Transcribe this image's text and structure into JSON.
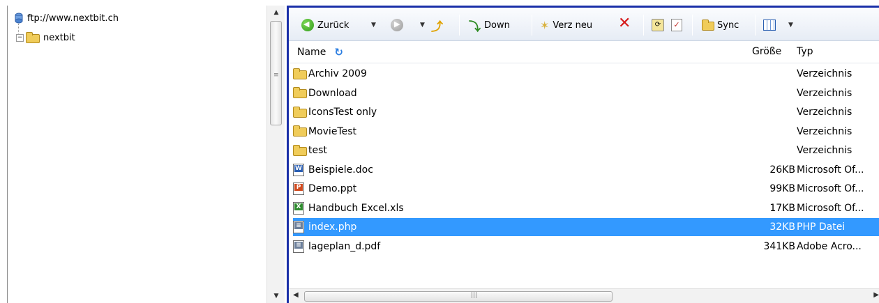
{
  "tree": {
    "root_label": "ftp://www.nextbit.ch",
    "child_label": "nextbit",
    "expander_symbol": "−"
  },
  "toolbar": {
    "back_label": "Zurück",
    "down_label": "Down",
    "new_folder_label": "Verz neu",
    "sync_label": "Sync"
  },
  "list_header": {
    "name": "Name",
    "size": "Größe",
    "type": "Typ"
  },
  "files": [
    {
      "name": "Archiv 2009",
      "size": "",
      "type": "Verzeichnis",
      "icon": "folder-icon"
    },
    {
      "name": "Download",
      "size": "",
      "type": "Verzeichnis",
      "icon": "folder-icon"
    },
    {
      "name": "IconsTest only",
      "size": "",
      "type": "Verzeichnis",
      "icon": "folder-icon"
    },
    {
      "name": "MovieTest",
      "size": "",
      "type": "Verzeichnis",
      "icon": "folder-icon"
    },
    {
      "name": "test",
      "size": "",
      "type": "Verzeichnis",
      "icon": "folder-icon"
    },
    {
      "name": "Beispiele.doc",
      "size": "26KB",
      "type": "Microsoft Of...",
      "icon": "word-doc-icon"
    },
    {
      "name": "Demo.ppt",
      "size": "99KB",
      "type": "Microsoft Of...",
      "icon": "powerpoint-doc-icon"
    },
    {
      "name": "Handbuch Excel.xls",
      "size": "17KB",
      "type": "Microsoft Of...",
      "icon": "excel-doc-icon"
    },
    {
      "name": "index.php",
      "size": "32KB",
      "type": "PHP Datei",
      "icon": "php-file-icon",
      "selected": true
    },
    {
      "name": "lageplan_d.pdf",
      "size": "341KB",
      "type": "Adobe Acro...",
      "icon": "pdf-file-icon"
    }
  ],
  "colors": {
    "selection": "#3399ff",
    "frame_border": "#1a2fa8"
  }
}
